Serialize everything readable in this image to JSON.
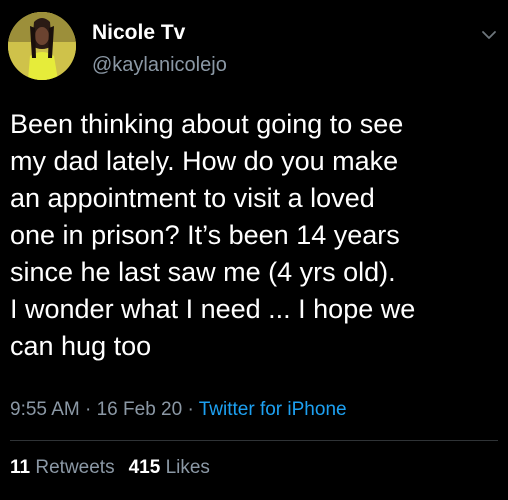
{
  "author": {
    "display_name": "Nicole Tv",
    "handle": "@kaylanicolejo",
    "avatar_icon": "profile-photo-avatar"
  },
  "menu_icon": "chevron-down-icon",
  "tweet": {
    "lines": [
      "Been thinking about going to see",
      "my dad lately. How do you make",
      "an appointment to visit a loved",
      "one in prison? It’s been 14 years",
      "since he last saw me (4 yrs old).",
      "I wonder what I need ... I hope we",
      "can hug too"
    ]
  },
  "meta": {
    "time": "9:55 AM",
    "separator": "·",
    "date": "16 Feb 20",
    "source": "Twitter for iPhone"
  },
  "stats": {
    "retweets_count": "11",
    "retweets_label": "Retweets",
    "likes_count": "415",
    "likes_label": "Likes"
  },
  "colors": {
    "background": "#000000",
    "text": "#ffffff",
    "secondary": "#8b98a5",
    "link": "#1da1f2",
    "divider": "#2f3336"
  }
}
